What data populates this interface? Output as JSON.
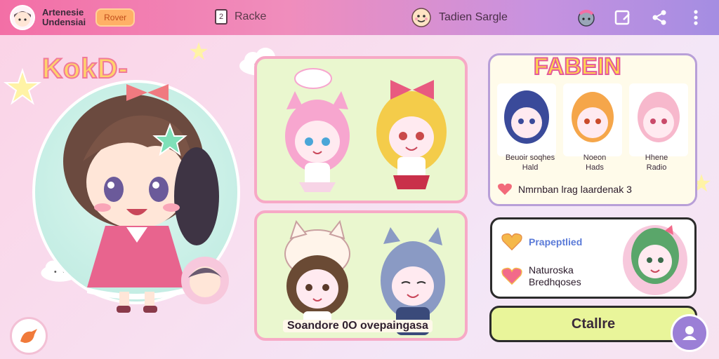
{
  "header": {
    "brand_line1": "Artenesie",
    "brand_line2": "Undensiai",
    "pill_label": "Rover",
    "card_icon_text": "2",
    "nav_label": "Racke",
    "user_label": "Tadien Sargle"
  },
  "hero": {
    "title": "KokD-"
  },
  "center": {
    "caption": "Soandore 0O ovepaingasa"
  },
  "right_top": {
    "title": "FABEIN",
    "labels": [
      {
        "line1": "Beuoir soqhes",
        "line2": "Hald"
      },
      {
        "line1": "Noeon",
        "line2": "Hads"
      },
      {
        "line1": "Hhene",
        "line2": "Radio"
      }
    ],
    "heart_text": "Nmrnban lrag laardenak 3"
  },
  "right_mid": {
    "feature1": "Prapeptlied",
    "feature2_line1": "Naturoska",
    "feature2_line2": "Bredhqoses"
  },
  "create_button": {
    "label": "Ctallre"
  },
  "colors": {
    "topbar_start": "#f36fa6",
    "topbar_end": "#a48de2",
    "panel_green": "#eaf7cf",
    "accent_pink": "#f7a9c6",
    "button_yellow": "#e9f59a"
  }
}
